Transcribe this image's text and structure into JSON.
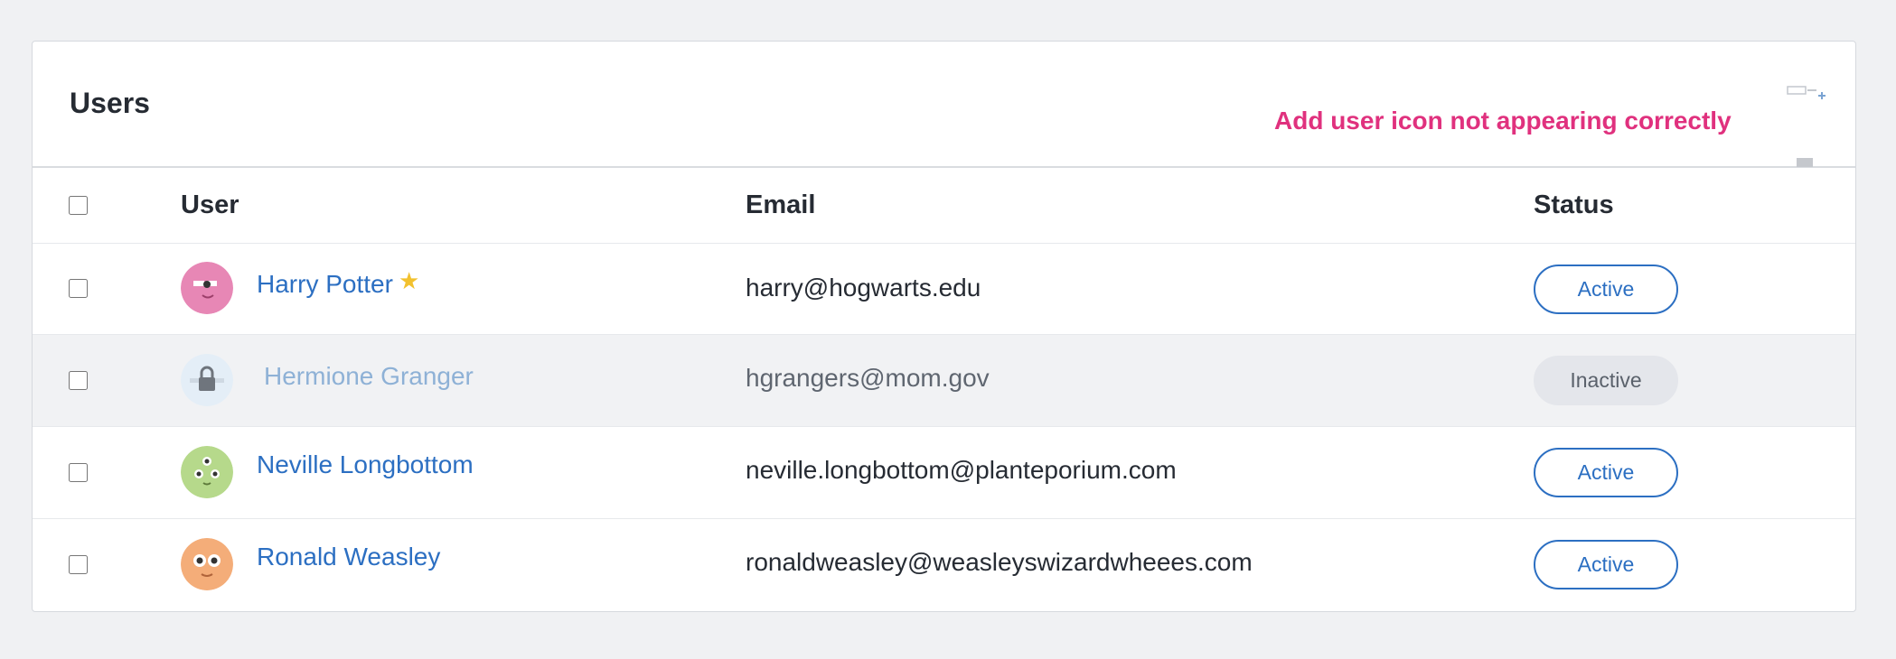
{
  "card": {
    "title": "Users",
    "note": "Add user icon not appearing correctly",
    "add_user_icon": "add-user-icon"
  },
  "table": {
    "headers": {
      "user": "User",
      "email": "Email",
      "status": "Status"
    },
    "rows": [
      {
        "name": "Harry Potter",
        "email": "harry@hogwarts.edu",
        "status": "Active",
        "avatar_color": "#e787b5",
        "starred": true,
        "locked": false
      },
      {
        "name": "Hermione Granger",
        "email": "hgrangers@mom.gov",
        "status": "Inactive",
        "avatar_color": "#e4eef7",
        "starred": false,
        "locked": true
      },
      {
        "name": "Neville Longbottom",
        "email": "neville.longbottom@planteporium.com",
        "status": "Active",
        "avatar_color": "#b6d98b",
        "starred": false,
        "locked": false
      },
      {
        "name": "Ronald Weasley",
        "email": "ronaldweasley@weasleyswizardwheees.com",
        "status": "Active",
        "avatar_color": "#f4ad79",
        "starred": false,
        "locked": false
      }
    ]
  },
  "colors": {
    "accent": "#2c6fc2",
    "note": "#e0317e",
    "star": "#f2c12e"
  }
}
